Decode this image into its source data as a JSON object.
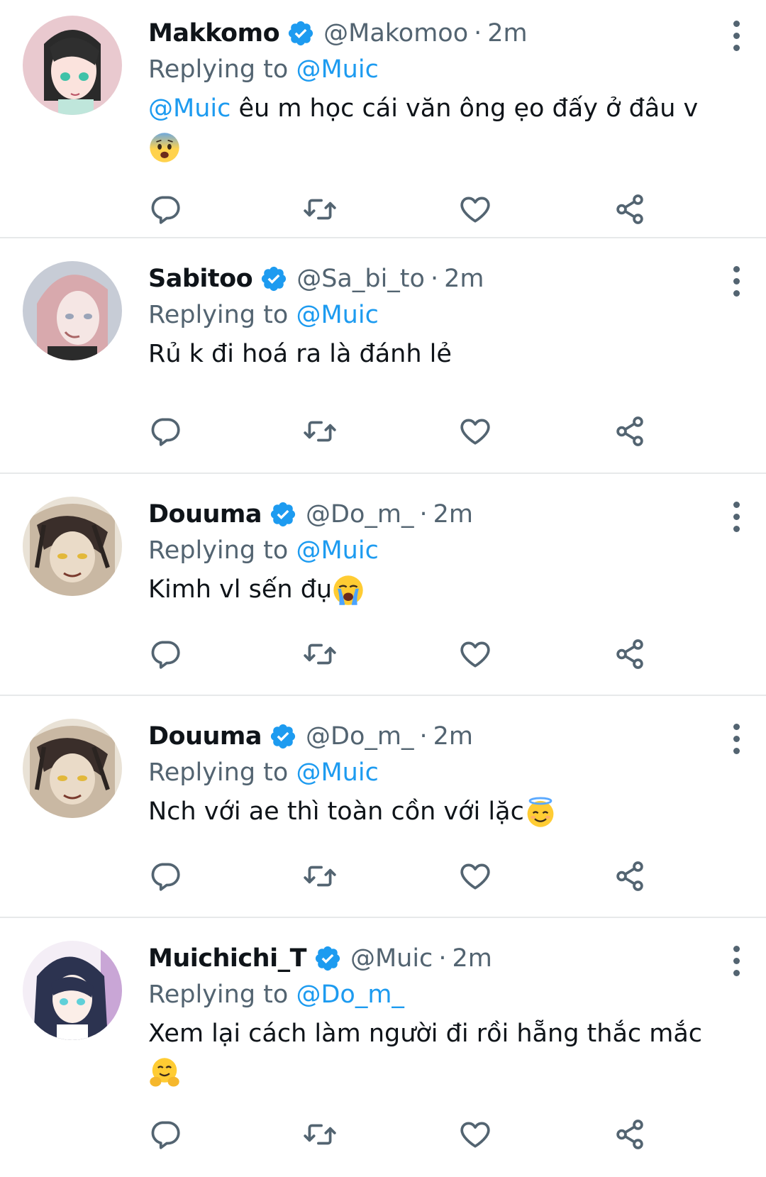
{
  "tweets": [
    {
      "name": "Makkomo",
      "handle": "@Makomoo",
      "separator": "·",
      "time": "2m",
      "replying_prefix": "Replying to",
      "replying_to": "@Muic",
      "text_mention": "@Muic",
      "text": " êu m học cái văn ông ẹo đấy ở đâu v",
      "emoji": "anxious-face"
    },
    {
      "name": "Sabitoo",
      "handle": "@Sa_bi_to",
      "separator": "·",
      "time": "2m",
      "replying_prefix": "Replying to",
      "replying_to": "@Muic",
      "text": "Rủ k đi hoá ra là đánh lẻ"
    },
    {
      "name": "Douuma",
      "handle": "@Do_m_",
      "separator": "·",
      "time": "2m",
      "replying_prefix": "Replying to",
      "replying_to": "@Muic",
      "text": "Kimh vl sến đụ",
      "emoji": "loudly-crying-face"
    },
    {
      "name": "Douuma",
      "handle": "@Do_m_",
      "separator": "·",
      "time": "2m",
      "replying_prefix": "Replying to",
      "replying_to": "@Muic",
      "text": "Nch với ae thì toàn cồn với lặc",
      "emoji": "smiling-face-with-halo"
    },
    {
      "name": "Muichichi_T",
      "handle": "@Muic",
      "separator": "·",
      "time": "2m",
      "replying_prefix": "Replying to",
      "replying_to": "@Do_m_",
      "text": "Xem lại cách làm người đi rồi hẵng thắc mắc",
      "emoji": "hugging-face"
    }
  ],
  "colors": {
    "accent": "#1d9bf0",
    "muted": "#536471",
    "text": "#0f1419",
    "divider": "#e7e9ea"
  },
  "icons": [
    "verified-badge-icon",
    "more-icon",
    "reply-icon",
    "retweet-icon",
    "like-icon",
    "share-icon"
  ]
}
